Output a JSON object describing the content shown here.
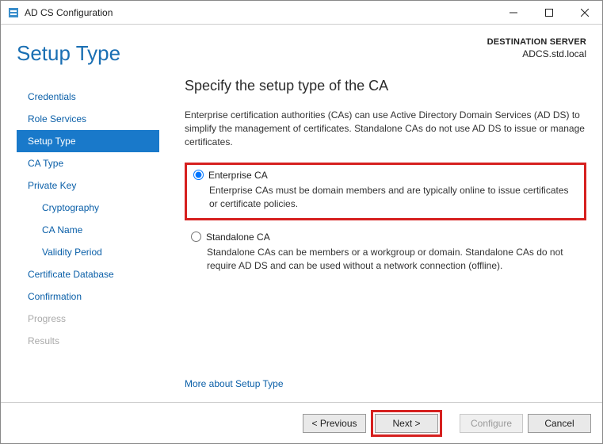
{
  "window": {
    "title": "AD CS Configuration"
  },
  "header": {
    "page_title": "Setup Type",
    "dest_label": "DESTINATION SERVER",
    "dest_server": "ADCS.std.local"
  },
  "sidebar": {
    "items": [
      {
        "label": "Credentials",
        "selected": false,
        "disabled": false,
        "child": false
      },
      {
        "label": "Role Services",
        "selected": false,
        "disabled": false,
        "child": false
      },
      {
        "label": "Setup Type",
        "selected": true,
        "disabled": false,
        "child": false
      },
      {
        "label": "CA Type",
        "selected": false,
        "disabled": false,
        "child": false
      },
      {
        "label": "Private Key",
        "selected": false,
        "disabled": false,
        "child": false
      },
      {
        "label": "Cryptography",
        "selected": false,
        "disabled": false,
        "child": true
      },
      {
        "label": "CA Name",
        "selected": false,
        "disabled": false,
        "child": true
      },
      {
        "label": "Validity Period",
        "selected": false,
        "disabled": false,
        "child": true
      },
      {
        "label": "Certificate Database",
        "selected": false,
        "disabled": false,
        "child": false
      },
      {
        "label": "Confirmation",
        "selected": false,
        "disabled": false,
        "child": false
      },
      {
        "label": "Progress",
        "selected": false,
        "disabled": true,
        "child": false
      },
      {
        "label": "Results",
        "selected": false,
        "disabled": true,
        "child": false
      }
    ]
  },
  "main": {
    "heading": "Specify the setup type of the CA",
    "intro": "Enterprise certification authorities (CAs) can use Active Directory Domain Services (AD DS) to simplify the management of certificates. Standalone CAs do not use AD DS to issue or manage certificates.",
    "options": [
      {
        "label": "Enterprise CA",
        "desc": "Enterprise CAs must be domain members and are typically online to issue certificates or certificate policies.",
        "selected": true,
        "highlight": true
      },
      {
        "label": "Standalone CA",
        "desc": "Standalone CAs can be members or a workgroup or domain. Standalone CAs do not require AD DS and can be used without a network connection (offline).",
        "selected": false,
        "highlight": false
      }
    ],
    "more_link": "More about Setup Type"
  },
  "footer": {
    "previous": "< Previous",
    "next": "Next >",
    "configure": "Configure",
    "cancel": "Cancel"
  }
}
